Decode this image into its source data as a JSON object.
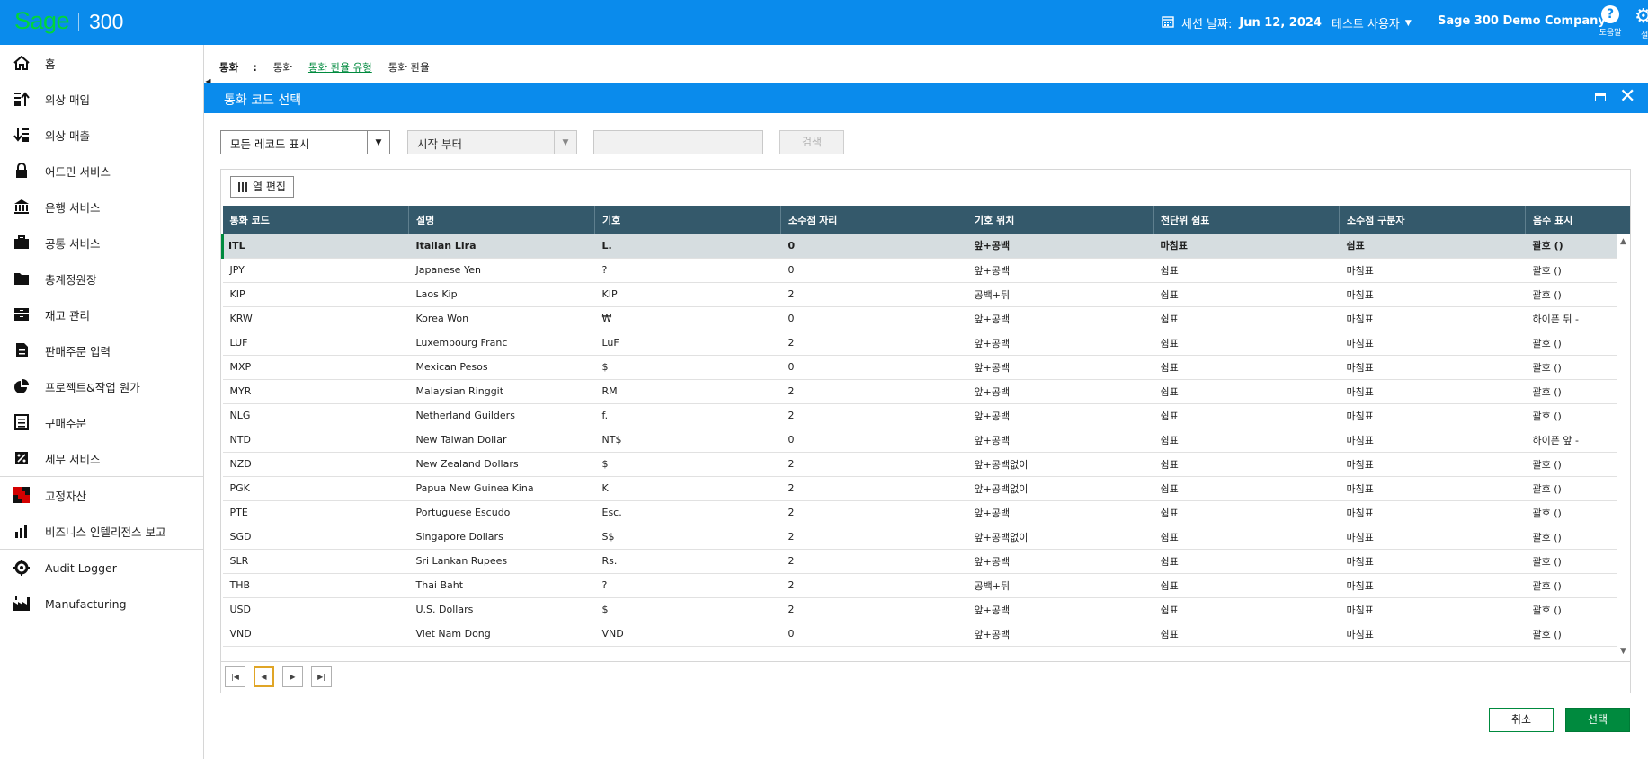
{
  "header": {
    "logo_brand": "Sage",
    "logo_product": "300",
    "session_label": "세션 날짜:",
    "session_date": "Jun 12, 2024",
    "user": "테스트 사용자",
    "company": "Sage 300 Demo Company",
    "help_label": "도움말",
    "settings_label": "설"
  },
  "sidebar": {
    "items": [
      {
        "label": "홈",
        "icon": "home-icon"
      },
      {
        "label": "외상 매입",
        "icon": "accounts-payable-icon"
      },
      {
        "label": "외상 매출",
        "icon": "accounts-receivable-icon"
      },
      {
        "label": "어드민 서비스",
        "icon": "lock-icon"
      },
      {
        "label": "은행 서비스",
        "icon": "bank-icon"
      },
      {
        "label": "공통 서비스",
        "icon": "briefcase-icon"
      },
      {
        "label": "총계정원장",
        "icon": "folder-icon"
      },
      {
        "label": "재고 관리",
        "icon": "inventory-icon"
      },
      {
        "label": "판매주문 입력",
        "icon": "order-icon"
      },
      {
        "label": "프로젝트&작업 원가",
        "icon": "pie-icon"
      },
      {
        "label": "구매주문",
        "icon": "purchase-icon"
      },
      {
        "label": "세무 서비스",
        "icon": "percent-icon"
      },
      {
        "label": "고정자산",
        "icon": "fixed-assets-icon"
      },
      {
        "label": "비즈니스 인텔리전스 보고",
        "icon": "bar-chart-icon"
      },
      {
        "label": "Audit Logger",
        "icon": "gear-icon"
      },
      {
        "label": "Manufacturing",
        "icon": "factory-icon"
      }
    ]
  },
  "breadcrumb": {
    "title": "통화",
    "colon": ":",
    "items": [
      "통화",
      "통화 환율 유형",
      "통화 환율"
    ]
  },
  "dialog": {
    "title": "통화 코드 선택",
    "filter_mode": "모든 레코드 표시",
    "filter_start": "시작 부터",
    "search_value": "",
    "search_button": "검색",
    "column_edit": "열 편집",
    "cancel_button": "취소",
    "select_button": "선택"
  },
  "grid": {
    "columns": [
      "통화 코드",
      "설명",
      "기호",
      "소수점 자리",
      "기호 위치",
      "천단위 쉼표",
      "소수점 구분자",
      "음수 표시"
    ],
    "rows": [
      [
        "ITL",
        "Italian Lira",
        "L.",
        "0",
        "앞+공백",
        "마침표",
        "쉼표",
        "괄호 ()"
      ],
      [
        "JPY",
        "Japanese Yen",
        "?",
        "0",
        "앞+공백",
        "쉼표",
        "마침표",
        "괄호 ()"
      ],
      [
        "KIP",
        "Laos Kip",
        "KIP",
        "2",
        "공백+뒤",
        "쉼표",
        "마침표",
        "괄호 ()"
      ],
      [
        "KRW",
        "Korea Won",
        "₩",
        "0",
        "앞+공백",
        "쉼표",
        "마침표",
        "하이픈 뒤 -"
      ],
      [
        "LUF",
        "Luxembourg Franc",
        "LuF",
        "2",
        "앞+공백",
        "쉼표",
        "마침표",
        "괄호 ()"
      ],
      [
        "MXP",
        "Mexican Pesos",
        "$",
        "0",
        "앞+공백",
        "쉼표",
        "마침표",
        "괄호 ()"
      ],
      [
        "MYR",
        "Malaysian Ringgit",
        "RM",
        "2",
        "앞+공백",
        "쉼표",
        "마침표",
        "괄호 ()"
      ],
      [
        "NLG",
        "Netherland Guilders",
        "f.",
        "2",
        "앞+공백",
        "쉼표",
        "마침표",
        "괄호 ()"
      ],
      [
        "NTD",
        "New Taiwan Dollar",
        "NT$",
        "0",
        "앞+공백",
        "쉼표",
        "마침표",
        "하이픈 앞 -"
      ],
      [
        "NZD",
        "New Zealand Dollars",
        "$",
        "2",
        "앞+공백없이",
        "쉼표",
        "마침표",
        "괄호 ()"
      ],
      [
        "PGK",
        "Papua New Guinea Kina",
        "K",
        "2",
        "앞+공백없이",
        "쉼표",
        "마침표",
        "괄호 ()"
      ],
      [
        "PTE",
        "Portuguese Escudo",
        "Esc.",
        "2",
        "앞+공백",
        "쉼표",
        "마침표",
        "괄호 ()"
      ],
      [
        "SGD",
        "Singapore Dollars",
        "S$",
        "2",
        "앞+공백없이",
        "쉼표",
        "마침표",
        "괄호 ()"
      ],
      [
        "SLR",
        "Sri Lankan Rupees",
        "Rs.",
        "2",
        "앞+공백",
        "쉼표",
        "마침표",
        "괄호 ()"
      ],
      [
        "THB",
        "Thai Baht",
        "?",
        "2",
        "공백+뒤",
        "쉼표",
        "마침표",
        "괄호 ()"
      ],
      [
        "USD",
        "U.S. Dollars",
        "$",
        "2",
        "앞+공백",
        "쉼표",
        "마침표",
        "괄호 ()"
      ],
      [
        "VND",
        "Viet Nam Dong",
        "VND",
        "0",
        "앞+공백",
        "쉼표",
        "마침표",
        "괄호 ()"
      ]
    ],
    "selected_row": 0
  },
  "pager": [
    "first-page",
    "previous-page",
    "next-page",
    "last-page"
  ],
  "colors": {
    "brand_blue": "#0a8bec",
    "header_teal": "#34596b",
    "accent_green": "#008a3e"
  }
}
